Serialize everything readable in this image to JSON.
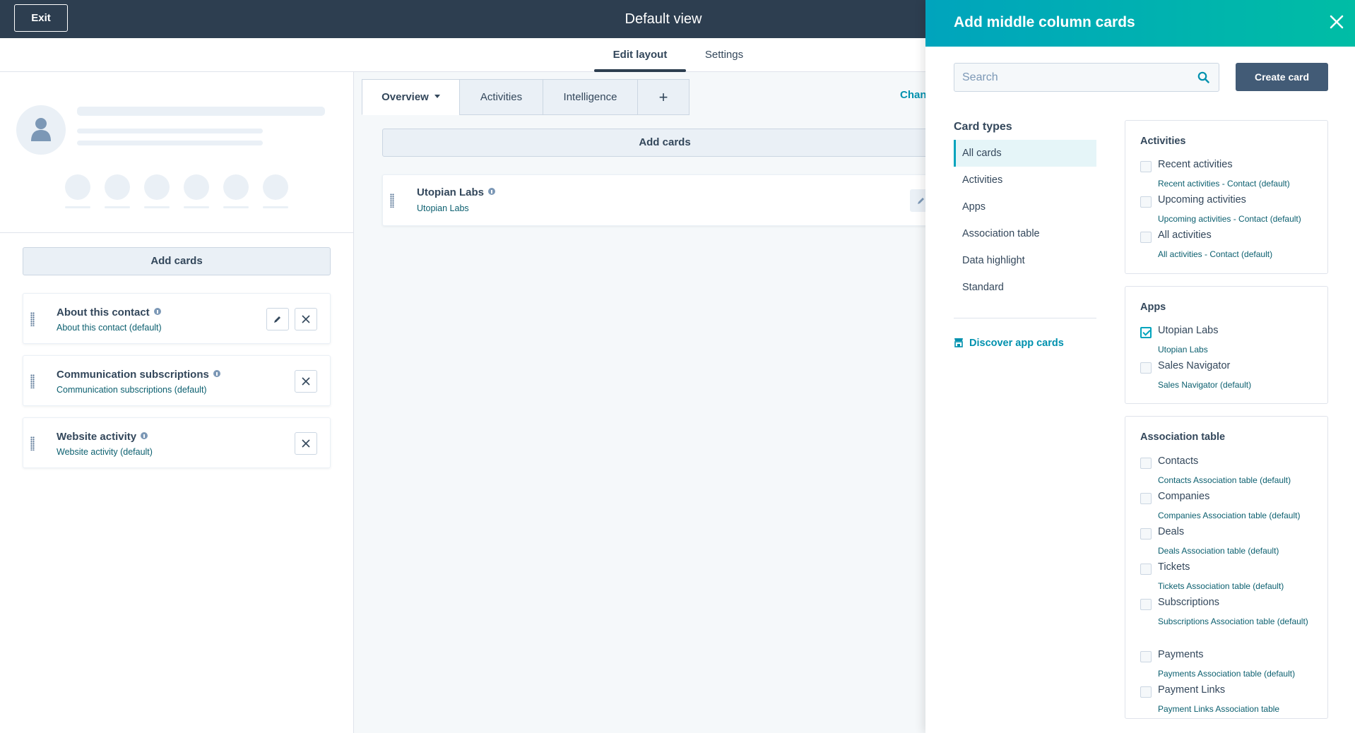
{
  "topbar": {
    "exit_label": "Exit",
    "title": "Default view"
  },
  "tabs": [
    {
      "label": "Edit layout",
      "active": true
    },
    {
      "label": "Settings",
      "active": false
    }
  ],
  "left": {
    "add_cards_label": "Add cards",
    "cards": [
      {
        "title": "About this contact",
        "subtitle": "About this contact (default)",
        "editable": true
      },
      {
        "title": "Communication subscriptions",
        "subtitle": "Communication subscriptions (default)",
        "editable": false
      },
      {
        "title": "Website activity",
        "subtitle": "Website activity (default)",
        "editable": false
      }
    ]
  },
  "middle": {
    "tabs": [
      {
        "label": "Overview"
      },
      {
        "label": "Activities"
      },
      {
        "label": "Intelligence"
      },
      {
        "label": "+"
      }
    ],
    "change_link": "Chan",
    "add_cards_label": "Add cards",
    "card": {
      "title": "Utopian Labs",
      "subtitle": "Utopian Labs"
    }
  },
  "panel": {
    "title": "Add middle column cards",
    "search_placeholder": "Search",
    "create_label": "Create card",
    "card_types_heading": "Card types",
    "card_types": [
      "All cards",
      "Activities",
      "Apps",
      "Association table",
      "Data highlight",
      "Standard"
    ],
    "card_types_active_index": 0,
    "discover_label": "Discover app cards",
    "groups": [
      {
        "title": "Activities",
        "options": [
          {
            "label": "Recent activities",
            "sub": "Recent activities - Contact (default)",
            "checked": false
          },
          {
            "label": "Upcoming activities",
            "sub": "Upcoming activities - Contact (default)",
            "checked": false
          },
          {
            "label": "All activities",
            "sub": "All activities - Contact (default)",
            "checked": false
          }
        ]
      },
      {
        "title": "Apps",
        "options": [
          {
            "label": "Utopian Labs",
            "sub": "Utopian Labs",
            "checked": true
          },
          {
            "label": "Sales Navigator",
            "sub": "Sales Navigator (default)",
            "checked": false
          }
        ]
      },
      {
        "title": "Association table",
        "options": [
          {
            "label": "Contacts",
            "sub": "Contacts Association table (default)",
            "checked": false
          },
          {
            "label": "Companies",
            "sub": "Companies Association table (default)",
            "checked": false
          },
          {
            "label": "Deals",
            "sub": "Deals Association table (default)",
            "checked": false
          },
          {
            "label": "Tickets",
            "sub": "Tickets Association table (default)",
            "checked": false
          },
          {
            "label": "Subscriptions",
            "sub": "Subscriptions Association table (default)",
            "checked": false
          },
          {
            "label": "Payments",
            "sub": "Payments Association table (default)",
            "checked": false
          },
          {
            "label": "Payment Links",
            "sub": "Payment Links Association table",
            "checked": false
          }
        ]
      }
    ]
  },
  "colors": {
    "topbar": "#2d3e50",
    "panel_header": "#00bda5",
    "link": "#0091ae",
    "primary_button": "#425b76"
  },
  "icons": {
    "close": "close-icon",
    "search": "search-icon",
    "edit": "pencil-icon",
    "remove": "x-icon",
    "drag": "drag-handle-icon",
    "info": "info-icon",
    "store": "marketplace-icon"
  }
}
